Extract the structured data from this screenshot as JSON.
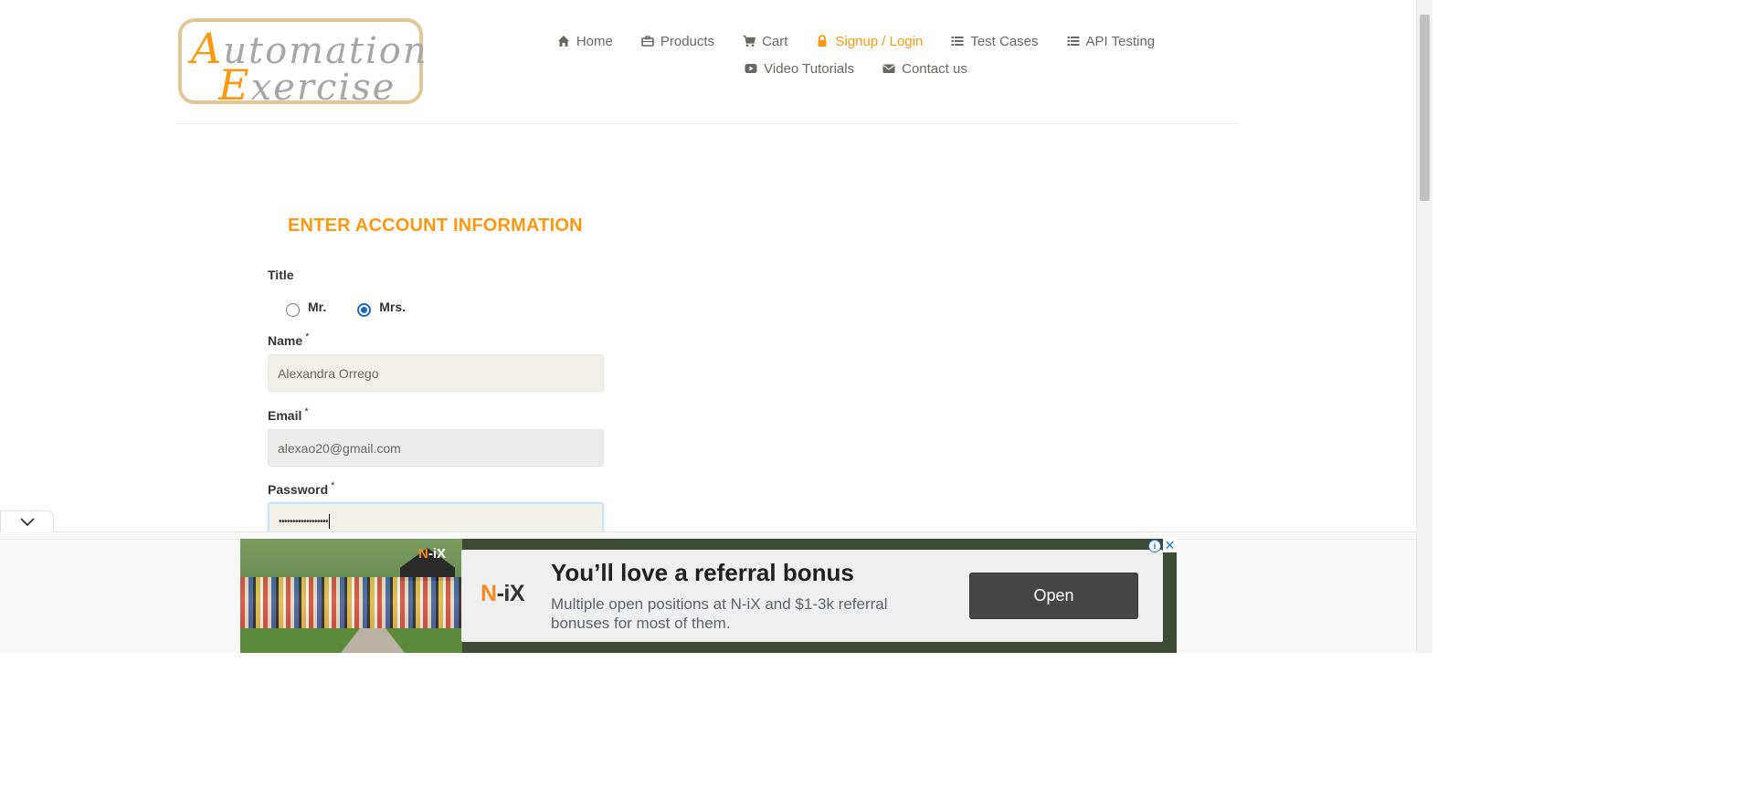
{
  "logo": {
    "line1_cap": "A",
    "line1_rest": "utomation",
    "line2_cap": "E",
    "line2_rest": "xercise"
  },
  "nav": {
    "row1": [
      {
        "label": "Home",
        "icon": "home-icon",
        "active": false
      },
      {
        "label": "Products",
        "icon": "briefcase-icon",
        "active": false
      },
      {
        "label": "Cart",
        "icon": "cart-icon",
        "active": false
      },
      {
        "label": "Signup / Login",
        "icon": "lock-icon",
        "active": true
      },
      {
        "label": "Test Cases",
        "icon": "list-icon",
        "active": false
      },
      {
        "label": "API Testing",
        "icon": "list-icon",
        "active": false
      }
    ],
    "row2": [
      {
        "label": "Video Tutorials",
        "icon": "youtube-play-icon",
        "active": false
      },
      {
        "label": "Contact us",
        "icon": "envelope-icon",
        "active": false
      }
    ]
  },
  "form": {
    "heading": "ENTER ACCOUNT INFORMATION",
    "title_label": "Title",
    "title_options": [
      {
        "label": "Mr.",
        "checked": false
      },
      {
        "label": "Mrs.",
        "checked": true
      }
    ],
    "required_mark": "*",
    "name": {
      "label": "Name",
      "value": "Alexandra Orrego"
    },
    "email": {
      "label": "Email",
      "value": "alexao20@gmail.com"
    },
    "password": {
      "label": "Password",
      "value": "••••••••••••••••••"
    }
  },
  "ad": {
    "photo_logo_a": "N",
    "photo_logo_b": "-iX",
    "brand_a": "N",
    "brand_b": "-iX",
    "headline": "You’ll love a referral bonus",
    "description": "Multiple open positions at N-iX and $1-3k referral bonuses for most of them.",
    "button": "Open",
    "info_glyph": "i",
    "close_glyph": "✕",
    "collapse_glyph": "⌄"
  },
  "colors": {
    "accent": "#fe980f",
    "text": "#696763",
    "radio_checked": "#1a67c9"
  }
}
